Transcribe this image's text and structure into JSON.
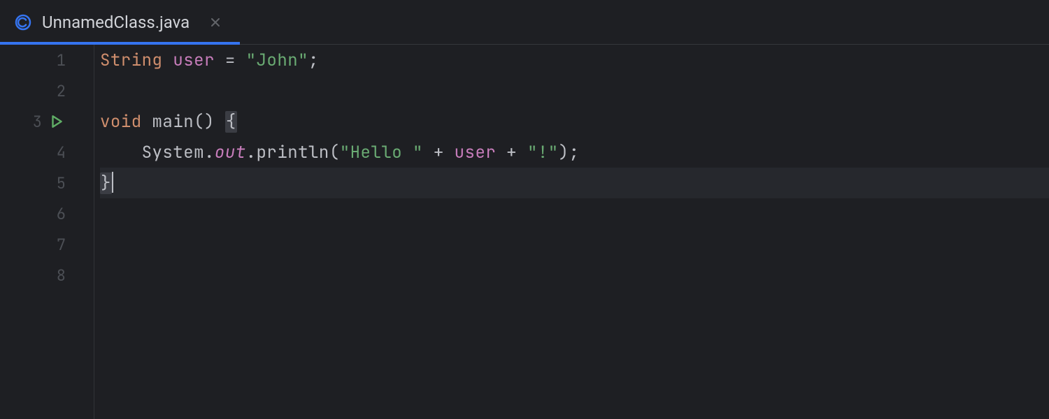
{
  "tab": {
    "title": "UnnamedClass.java",
    "active": true
  },
  "gutter": {
    "line_numbers": [
      "1",
      "2",
      "3",
      "4",
      "5",
      "6",
      "7",
      "8"
    ],
    "run_on_line": 3
  },
  "code": {
    "l1": {
      "kw": "String",
      "var": "user",
      "eq": " = ",
      "str": "\"John\"",
      "semi": ";"
    },
    "l2": "",
    "l3": {
      "kw": "void",
      "name": "main",
      "paren": "()",
      "sp": " ",
      "brace": "{"
    },
    "l4": {
      "indent": "    ",
      "cls": "System",
      "dot1": ".",
      "out": "out",
      "dot2": ".",
      "fn": "println",
      "open": "(",
      "s1": "\"Hello \"",
      "p1": " + ",
      "v": "user",
      "p2": " + ",
      "s2": "\"!\"",
      "close": ")",
      "semi": ";"
    },
    "l5": {
      "brace": "}"
    }
  },
  "current_line": 5
}
